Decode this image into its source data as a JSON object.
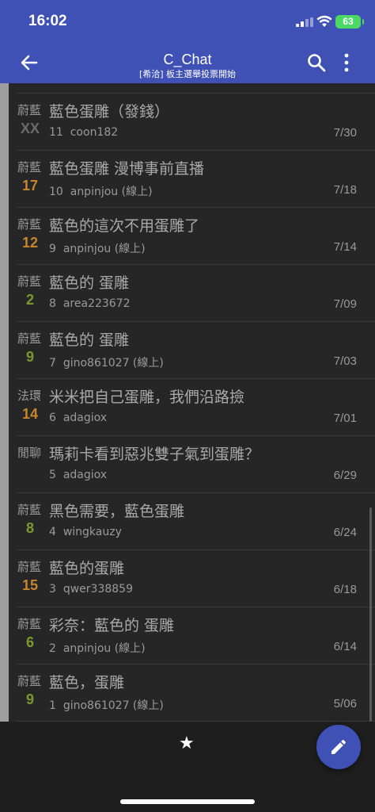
{
  "status": {
    "time": "16:02",
    "battery": "63"
  },
  "header": {
    "title": "C_Chat",
    "subtitle": "[希洽] 板主選舉投票開始"
  },
  "colors": {
    "app_bar": "#3f51b5",
    "fab": "#3f51b5",
    "battery": "#4cd964"
  },
  "icons": {
    "back": "arrow-left",
    "search": "magnifier",
    "more": "vertical-dots",
    "star": "star",
    "fab": "pencil"
  },
  "posts": [
    {
      "category": "蔚藍",
      "count": "XX",
      "count_color": "#6a6a6a",
      "subject": "藍色蛋雕（發錢）",
      "index": "11",
      "author": "coon182",
      "date": "7/30"
    },
    {
      "category": "蔚藍",
      "count": "17",
      "count_color": "#c8862a",
      "subject": "藍色蛋雕 漫博事前直播",
      "index": "10",
      "author": "anpinjou (線上)",
      "date": "7/18"
    },
    {
      "category": "蔚藍",
      "count": "12",
      "count_color": "#c8862a",
      "subject": "藍色的這次不用蛋雕了",
      "index": "9",
      "author": "anpinjou (線上)",
      "date": "7/14"
    },
    {
      "category": "蔚藍",
      "count": "2",
      "count_color": "#7a9a2e",
      "subject": "藍色的 蛋雕",
      "index": "8",
      "author": "area223672",
      "date": "7/09"
    },
    {
      "category": "蔚藍",
      "count": "9",
      "count_color": "#7a9a2e",
      "subject": "藍色的 蛋雕",
      "index": "7",
      "author": "gino861027 (線上)",
      "date": "7/03"
    },
    {
      "category": "法環",
      "count": "14",
      "count_color": "#c8862a",
      "subject": "米米把自己蛋雕，我們沿路撿",
      "index": "6",
      "author": "adagiox",
      "date": "7/01"
    },
    {
      "category": "閒聊",
      "count": "",
      "count_color": "#7a9a2e",
      "subject": "瑪莉卡看到惡兆雙子氣到蛋雕？",
      "index": "5",
      "author": "adagiox",
      "date": "6/29"
    },
    {
      "category": "蔚藍",
      "count": "8",
      "count_color": "#7a9a2e",
      "subject": "黑色需要，藍色蛋雕",
      "index": "4",
      "author": "wingkauzy",
      "date": "6/24"
    },
    {
      "category": "蔚藍",
      "count": "15",
      "count_color": "#c8862a",
      "subject": "藍色的蛋雕",
      "index": "3",
      "author": "qwer338859",
      "date": "6/18"
    },
    {
      "category": "蔚藍",
      "count": "6",
      "count_color": "#7a9a2e",
      "subject": "彩奈：藍色的 蛋雕",
      "index": "2",
      "author": "anpinjou (線上)",
      "date": "6/14"
    },
    {
      "category": "蔚藍",
      "count": "9",
      "count_color": "#7a9a2e",
      "subject": "藍色，蛋雕",
      "index": "1",
      "author": "gino861027 (線上)",
      "date": "5/06"
    }
  ]
}
